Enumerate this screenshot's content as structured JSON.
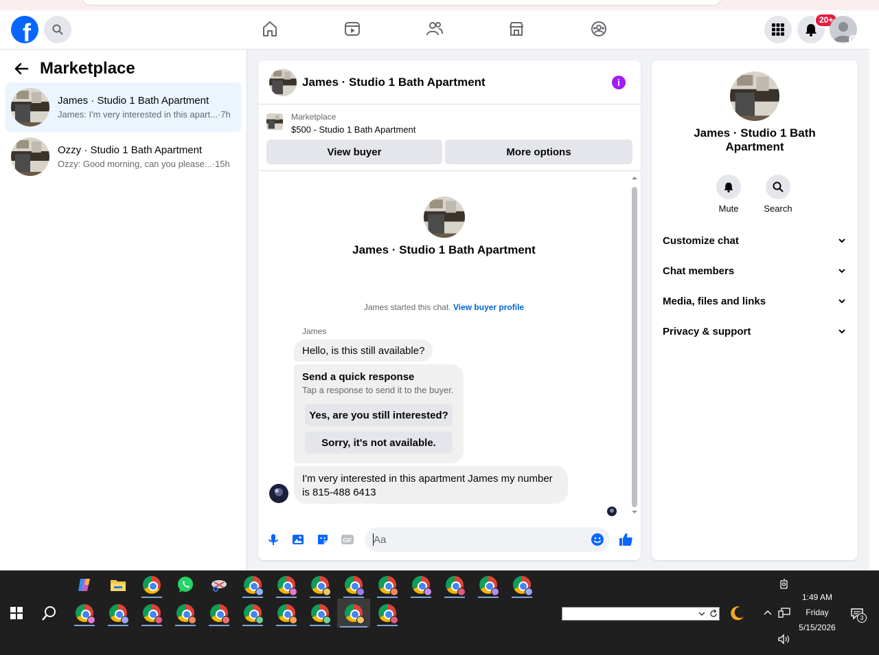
{
  "header": {
    "logo_letter": "f",
    "notifications_badge": "20+",
    "nav_icons": [
      "home-icon",
      "video-icon",
      "friends-icon",
      "marketplace-icon",
      "groups-icon"
    ],
    "right_icons": [
      "menu-grid-icon",
      "bell-icon",
      "account-avatar"
    ]
  },
  "sidebar": {
    "title": "Marketplace",
    "conversations": [
      {
        "name": "James · Studio 1 Bath Apartment",
        "preview": "James: I'm very interested in this apart...",
        "time": "·7h",
        "active": true
      },
      {
        "name": "Ozzy · Studio 1 Bath Apartment",
        "preview": "Ozzy: Good morning, can you please...",
        "time": "·15h",
        "active": false
      }
    ]
  },
  "chat": {
    "title": "James · Studio 1 Bath Apartment",
    "info_icon": "i",
    "listing_source": "Marketplace",
    "listing_title": "$500 - Studio 1 Bath Apartment",
    "view_buyer": "View buyer",
    "more_options": "More options",
    "intro_name": "James · Studio 1 Bath Apartment",
    "started_text": "James started this chat.",
    "view_buyer_profile": "View buyer profile",
    "sender": "James",
    "messages": [
      "Hello, is this still available?",
      "I'm very interested in this apartment James my number is 815-488 6413"
    ],
    "quick_response": {
      "title": "Send a quick response",
      "subtitle": "Tap a response to send it to the buyer.",
      "options": [
        "Yes, are you still interested?",
        "Sorry, it's not available."
      ]
    },
    "composer_placeholder": "Aa"
  },
  "details": {
    "name": "James · Studio 1 Bath Apartment",
    "actions": [
      {
        "label": "Mute"
      },
      {
        "label": "Search"
      }
    ],
    "sections": [
      "Customize chat",
      "Chat members",
      "Media, files and links",
      "Privacy & support"
    ]
  },
  "taskbar": {
    "time": "1:49 AM",
    "day": "Friday",
    "date": "5/15/2026",
    "notification_count": "3"
  },
  "colors": {
    "facebook_blue": "#0866ff",
    "link_blue": "#0064d1",
    "badge_red": "#e41e3f",
    "info_purple": "#a31cf2",
    "active_conversation": "#ebf5ff"
  }
}
